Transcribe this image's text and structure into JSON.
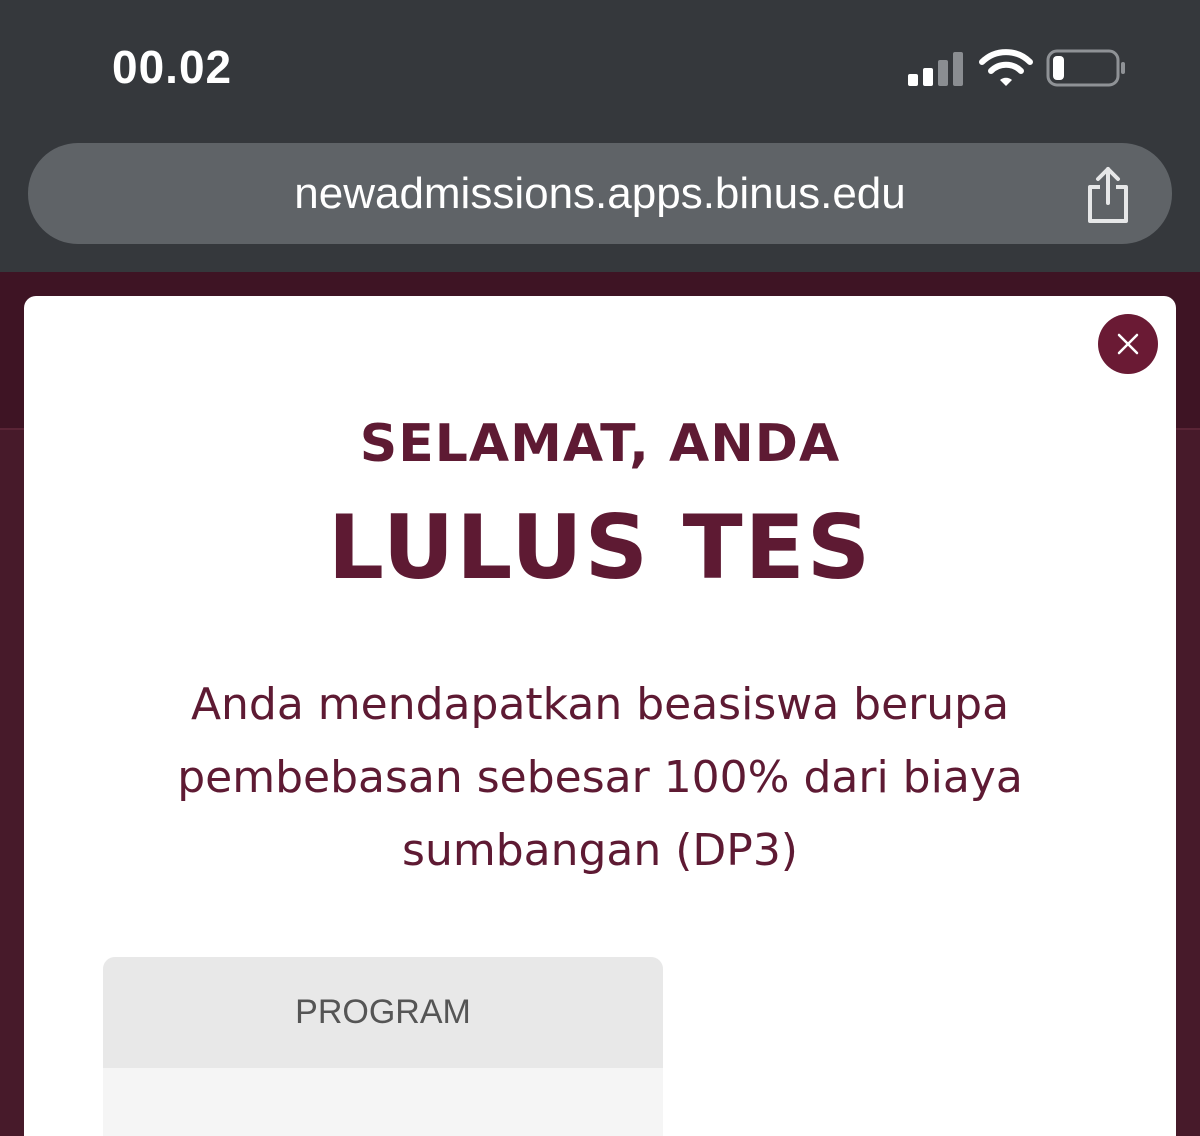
{
  "status_bar": {
    "time": "00.02",
    "signal_icon": "cellular-signal-icon",
    "wifi_icon": "wifi-icon",
    "battery_icon": "battery-low-icon"
  },
  "browser": {
    "url": "newadmissions.apps.binus.edu",
    "share_icon": "share-icon"
  },
  "modal": {
    "close_icon": "close-icon",
    "heading_sub": "SELAMAT, ANDA",
    "heading_main": "LULUS TES",
    "message_lines": [
      "Anda mendapatkan beasiswa berupa",
      "pembebasan sebesar 100% dari biaya",
      "sumbangan (DP3)"
    ],
    "program_label": "PROGRAM"
  },
  "colors": {
    "brand": "#5e1a33",
    "page_background": "#471a2a",
    "chrome": "#35383c"
  }
}
